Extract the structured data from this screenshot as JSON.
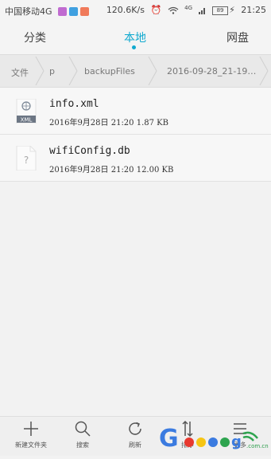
{
  "status_bar": {
    "carrier": "中国移动4G",
    "net_speed": "120.6K/s",
    "signal_label": "4G",
    "battery": "89",
    "time": "21:25",
    "app_icon_colors": [
      "#c06bd0",
      "#3fa0e0",
      "#f07a5a"
    ]
  },
  "tabs": [
    {
      "label": "分类",
      "active": false
    },
    {
      "label": "本地",
      "active": true
    },
    {
      "label": "网盘",
      "active": false
    }
  ],
  "breadcrumb": [
    "文件",
    "p",
    "backupFiles",
    "2016-09-28_21-19…"
  ],
  "files": [
    {
      "name": "info.xml",
      "meta": "2016年9月28日 21:20 1.87 KB",
      "icon": "xml-file-icon",
      "icon_text": "XML"
    },
    {
      "name": "wifiConfig.db",
      "meta": "2016年9月28日 21:20 12.00 KB",
      "icon": "unknown-file-icon",
      "icon_text": "?"
    }
  ],
  "bottom_bar": [
    {
      "label": "新建文件夹",
      "icon": "plus-icon"
    },
    {
      "label": "搜索",
      "icon": "search-icon"
    },
    {
      "label": "刷新",
      "icon": "refresh-icon"
    },
    {
      "label": "排序",
      "icon": "sort-icon"
    },
    {
      "label": "更多",
      "icon": "more-icon"
    }
  ],
  "watermark": {
    "logo_letters": "Gooogl",
    "host": ".com.cn"
  },
  "colors": {
    "accent": "#10a9cf"
  }
}
